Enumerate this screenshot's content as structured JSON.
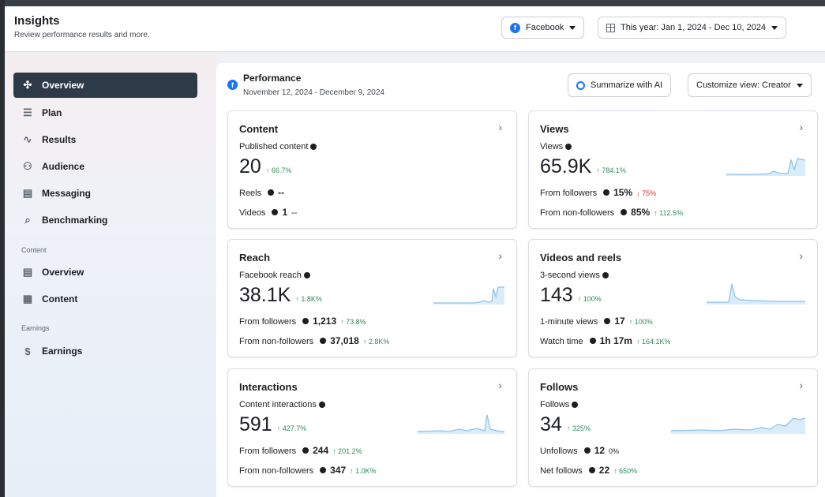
{
  "header": {
    "title": "Insights",
    "subtitle": "Review performance results and more.",
    "platform": "Facebook",
    "date_range": "This year: Jan 1, 2024 - Dec 10, 2024"
  },
  "sidebar": {
    "items": [
      {
        "label": "Overview",
        "icon": "sparkle-icon",
        "active": true
      },
      {
        "label": "Plan",
        "icon": "list-icon"
      },
      {
        "label": "Results",
        "icon": "trend-icon"
      },
      {
        "label": "Audience",
        "icon": "people-icon"
      },
      {
        "label": "Messaging",
        "icon": "message-icon"
      },
      {
        "label": "Benchmarking",
        "icon": "benchmark-icon"
      }
    ],
    "content_section": "Content",
    "content_items": [
      {
        "label": "Overview",
        "icon": "gallery-icon"
      },
      {
        "label": "Content",
        "icon": "table-icon"
      }
    ],
    "earnings_section": "Earnings",
    "earnings_items": [
      {
        "label": "Earnings",
        "icon": "dollar-icon"
      }
    ]
  },
  "performance": {
    "title": "Performance",
    "date": "November 12, 2024 - December 9, 2024",
    "summarize_label": "Summarize with AI",
    "customize_label": "Customize view: Creator"
  },
  "cards": {
    "content": {
      "title": "Content",
      "metric_label": "Published content",
      "value": "20",
      "delta": "↑ 66.7%",
      "row1_label": "Reels",
      "row1_value": "--",
      "row2_label": "Videos",
      "row2_value": "1",
      "row2_delta": "--"
    },
    "views": {
      "title": "Views",
      "metric_label": "Views",
      "value": "65.9K",
      "delta": "↑ 784.1%",
      "row1_label": "From followers",
      "row1_value": "15%",
      "row1_delta": "↓ 75%",
      "row2_label": "From non-followers",
      "row2_value": "85%",
      "row2_delta": "↑ 112.5%"
    },
    "reach": {
      "title": "Reach",
      "metric_label": "Facebook reach",
      "value": "38.1K",
      "delta": "↑ 1.8K%",
      "row1_label": "From followers",
      "row1_value": "1,213",
      "row1_delta": "↑ 73.8%",
      "row2_label": "From non-followers",
      "row2_value": "37,018",
      "row2_delta": "↑ 2.8K%"
    },
    "videos": {
      "title": "Videos and reels",
      "metric_label": "3-second views",
      "value": "143",
      "delta": "↑ 100%",
      "row1_label": "1-minute views",
      "row1_value": "17",
      "row1_delta": "↑ 100%",
      "row2_label": "Watch time",
      "row2_value": "1h 17m",
      "row2_delta": "↑ 164.1K%"
    },
    "interactions": {
      "title": "Interactions",
      "metric_label": "Content interactions",
      "value": "591",
      "delta": "↑ 427.7%",
      "row1_label": "From followers",
      "row1_value": "244",
      "row1_delta": "↑ 201.2%",
      "row2_label": "From non-followers",
      "row2_value": "347",
      "row2_delta": "↑ 1.0K%"
    },
    "follows": {
      "title": "Follows",
      "metric_label": "Follows",
      "value": "34",
      "delta": "↑ 325%",
      "row1_label": "Unfollows",
      "row1_value": "12",
      "row1_delta": "0%",
      "row2_label": "Net follows",
      "row2_value": "22",
      "row2_delta": "↑ 650%"
    }
  },
  "colors": {
    "accent": "#1877f2",
    "positive": "#2e8b57",
    "negative": "#d93025",
    "sparkline": "#8fc3ea"
  }
}
